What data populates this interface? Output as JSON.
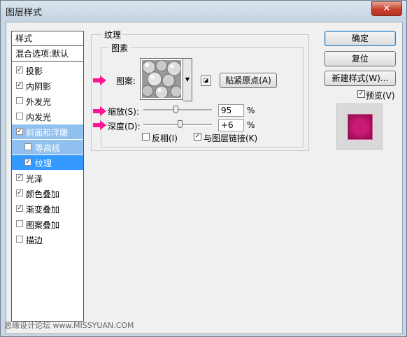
{
  "window": {
    "title": "图层样式",
    "close_glyph": "✕"
  },
  "left_panel": {
    "header": "样式",
    "blend_options": "混合选项:默认",
    "items": [
      {
        "label": "投影",
        "checked": true
      },
      {
        "label": "内阴影",
        "checked": true
      },
      {
        "label": "外发光",
        "checked": false
      },
      {
        "label": "内发光",
        "checked": false
      },
      {
        "label": "斜面和浮雕",
        "checked": true
      },
      {
        "label": "等高线",
        "checked": false
      },
      {
        "label": "纹理",
        "checked": true
      },
      {
        "label": "光泽",
        "checked": true
      },
      {
        "label": "颜色叠加",
        "checked": true
      },
      {
        "label": "渐变叠加",
        "checked": true
      },
      {
        "label": "图案叠加",
        "checked": false
      },
      {
        "label": "描边",
        "checked": false
      }
    ]
  },
  "texture": {
    "group_title": "纹理",
    "subgroup_title": "图素",
    "pattern_label": "图案:",
    "snap_origin_button": "贴紧原点(A)",
    "scale_label": "缩放(S):",
    "scale_value": "95",
    "scale_unit": "%",
    "scale_level": 95,
    "depth_label": "深度(D):",
    "depth_value": "+6",
    "depth_unit": "%",
    "invert_label": "反相(I)",
    "invert_checked": false,
    "link_label": "与图层链接(K)",
    "link_checked": true
  },
  "buttons": {
    "ok": "确定",
    "reset": "复位",
    "new_style": "新建样式(W)...",
    "preview_label": "预览(V)",
    "preview_checked": true
  },
  "watermark": "思缘设计论坛 www.MISSYUAN.COM",
  "colors": {
    "accent": "#ff1493",
    "selection": "#3399ff",
    "preview": "#c81a74"
  }
}
